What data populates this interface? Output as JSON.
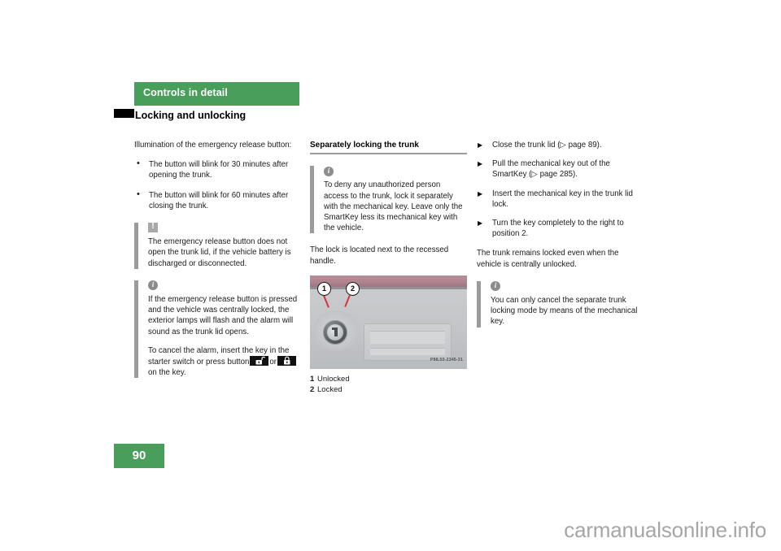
{
  "header": {
    "chapter": "Controls in detail",
    "section": "Locking and unlocking"
  },
  "page_number": "90",
  "watermark": "carmanualsonline.info",
  "left_column": {
    "intro": "Illumination of the emergency release button:",
    "bullets": [
      "The button will blink for 30 minutes after opening the trunk.",
      "The button will blink for 60 minutes after closing the trunk."
    ],
    "warning_note": {
      "icon": "warning-icon",
      "text": "The emergency release button does not open the trunk lid, if the vehicle battery is discharged or disconnected."
    },
    "info_note": {
      "icon": "info-icon",
      "paragraph1": "If the emergency release button is pressed and the vehicle was centrally locked, the exterior lamps will flash and the alarm will sound as the trunk lid opens.",
      "paragraph2_part1": "To cancel the alarm, insert the key in the starter switch or press button",
      "paragraph2_part2": "or",
      "paragraph2_part3": "on the key.",
      "button_unlock_icon": "unlock-button-icon",
      "button_lock_icon": "lock-button-icon"
    }
  },
  "middle_column": {
    "subheading": "Separately locking the trunk",
    "info_note": {
      "icon": "info-icon",
      "text": "To deny any unauthorized person access to the trunk, lock it separately with the mechanical key. Leave only the SmartKey less its mechanical key with the vehicle."
    },
    "paragraph": "The lock is located next to the recessed handle.",
    "figure": {
      "image_code": "P88.50-2345-31",
      "callouts": [
        "1",
        "2"
      ],
      "legend": [
        {
          "num": "1",
          "label": "Unlocked"
        },
        {
          "num": "2",
          "label": "Locked"
        }
      ]
    }
  },
  "right_column": {
    "steps": [
      "Close the trunk lid (▷ page 89).",
      "Pull the mechanical key out of the SmartKey (▷ page 285).",
      "Insert the mechanical key in the trunk lid lock.",
      "Turn the key completely to the right to position 2."
    ],
    "paragraph": "The trunk remains locked even when the vehicle is centrally unlocked.",
    "info_note": {
      "icon": "info-icon",
      "text": "You can only cancel the separate trunk locking mode by means of the mechanical key."
    }
  },
  "colors": {
    "accent_green": "#4a9e5c",
    "note_bar_gray": "#9b9b9b",
    "leader_red": "#d5333c",
    "watermark_gray": "#a6a6a6"
  }
}
